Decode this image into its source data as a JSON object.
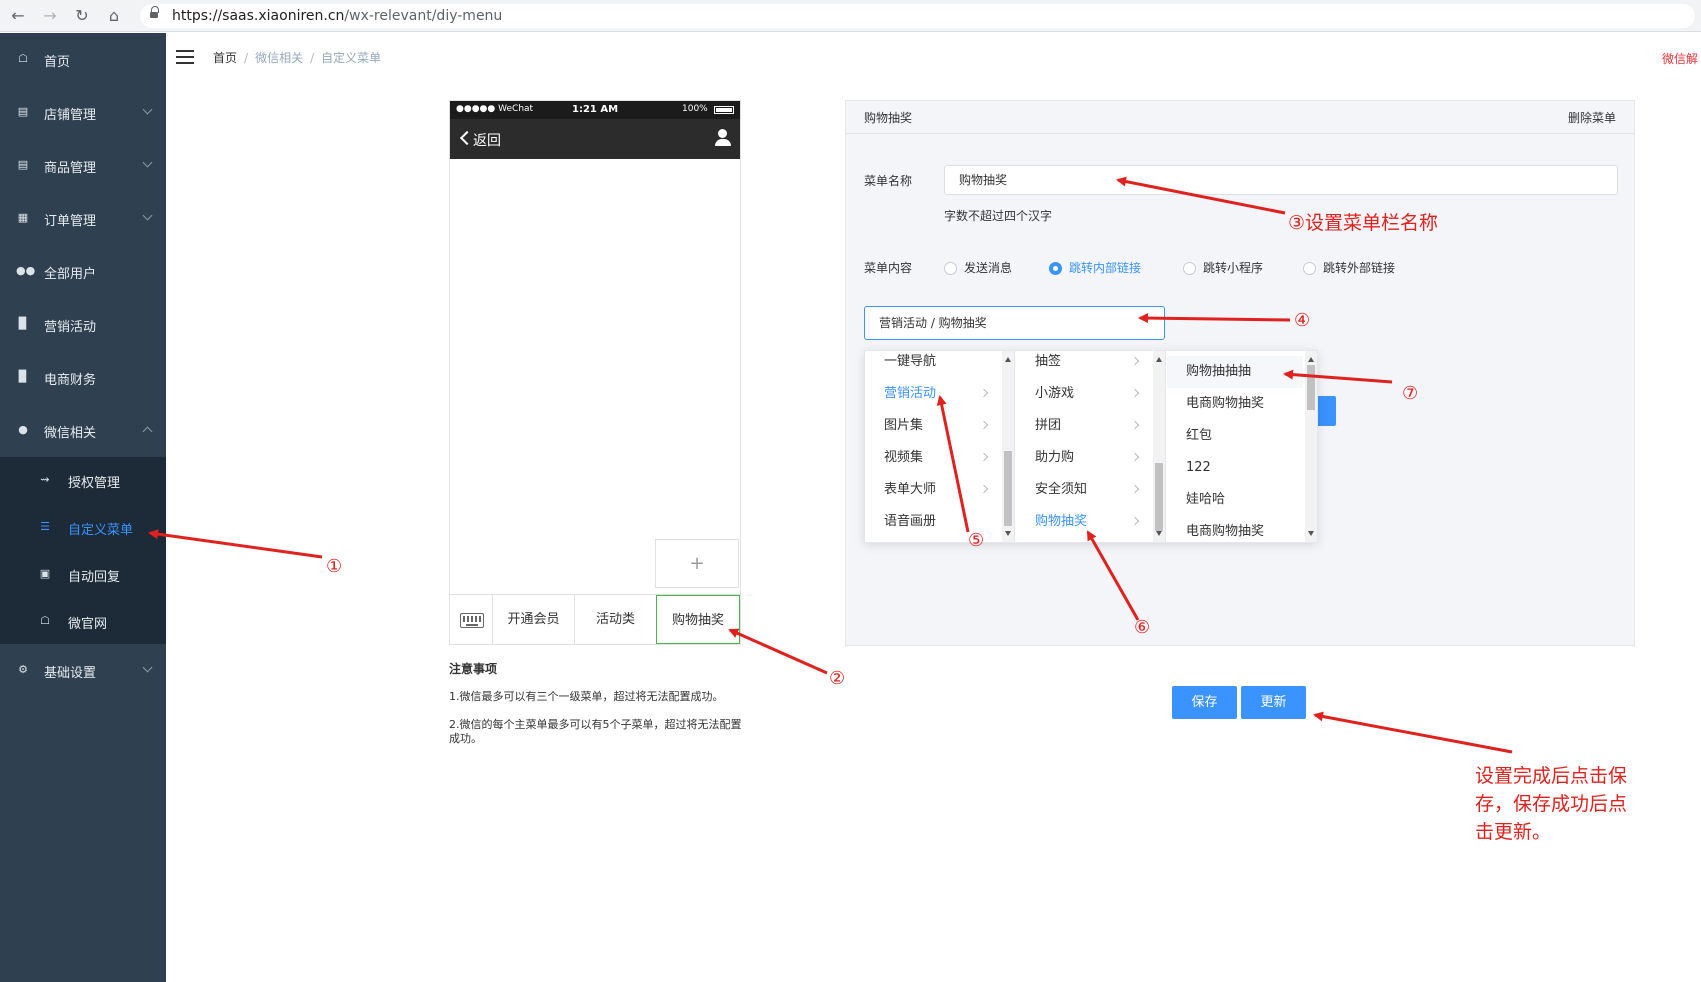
{
  "browser": {
    "url_main": "https://saas.xiaoniren.cn",
    "url_path": "/wx-relevant/diy-menu"
  },
  "sidebar": {
    "items": [
      {
        "label": "首页"
      },
      {
        "label": "店铺管理"
      },
      {
        "label": "商品管理"
      },
      {
        "label": "订单管理"
      },
      {
        "label": "全部用户"
      },
      {
        "label": "营销活动"
      },
      {
        "label": "电商财务"
      },
      {
        "label": "微信相关"
      },
      {
        "label": "基础设置"
      }
    ],
    "submenu": [
      {
        "label": "授权管理"
      },
      {
        "label": "自定义菜单"
      },
      {
        "label": "自动回复"
      },
      {
        "label": "微官网"
      }
    ]
  },
  "breadcrumb": {
    "home": "首页",
    "section": "微信相关",
    "current": "自定义菜单"
  },
  "top_right": "微信解",
  "phone": {
    "carrier": "●●●●● WeChat",
    "time": "1:21 AM",
    "battery": "100%",
    "back": "返回",
    "add": "+",
    "menus": [
      "开通会员",
      "活动类",
      "购物抽奖"
    ]
  },
  "notes": {
    "title": "注意事项",
    "line1": "1.微信最多可以有三个一级菜单，超过将无法配置成功。",
    "line2a": "2.微信的每个主菜单最多可以有5个子菜单，超过将无法配置",
    "line2b": "成功。"
  },
  "panel": {
    "title": "购物抽奖",
    "delete": "删除菜单",
    "name_label": "菜单名称",
    "name_value": "购物抽奖",
    "name_hint": "字数不超过四个汉字",
    "content_label": "菜单内容",
    "options": [
      "发送消息",
      "跳转内部链接",
      "跳转小程序",
      "跳转外部链接"
    ],
    "selected_option": "跳转内部链接",
    "cascade_value": "营销活动 / 购物抽奖"
  },
  "cascader": {
    "col1": [
      "一键导航",
      "营销活动",
      "图片集",
      "视频集",
      "表单大师",
      "语音画册"
    ],
    "col2": [
      "抽签",
      "小游戏",
      "拼团",
      "助力购",
      "安全须知",
      "购物抽奖"
    ],
    "col3": [
      "购物抽抽抽",
      "电商购物抽奖",
      "红包",
      "122",
      "娃哈哈",
      "电商购物抽奖"
    ]
  },
  "buttons": {
    "save": "保存",
    "update": "更新"
  },
  "annotations": {
    "n1": "①",
    "n2": "②",
    "n3": "③设置菜单栏名称",
    "n4": "④",
    "n5": "⑤",
    "n6": "⑥",
    "n7": "⑦",
    "note_line1": "设置完成后点击保",
    "note_line2": "存，保存成功后点",
    "note_line3": "击更新。"
  },
  "colors": {
    "sidebar": "#2f4050",
    "accent": "#3a93ff",
    "annotation": "#e0211e"
  }
}
